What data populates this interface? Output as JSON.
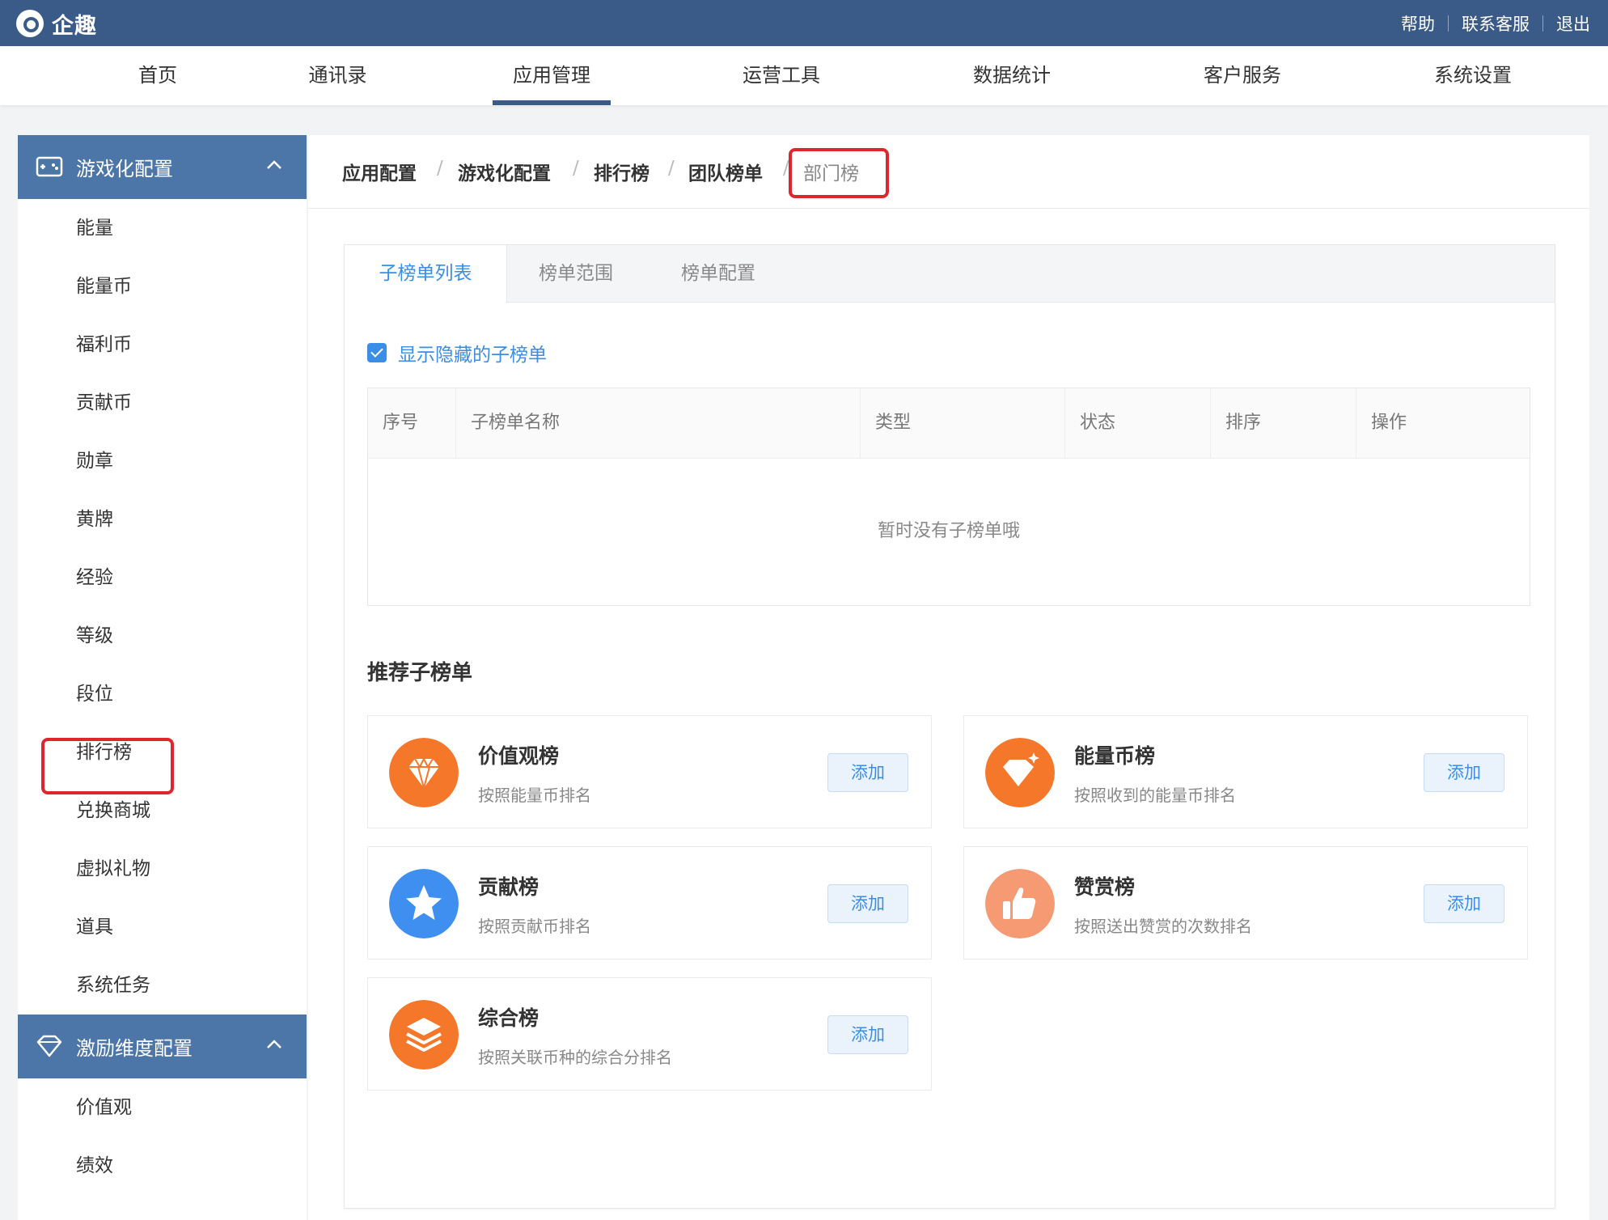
{
  "app": {
    "name": "企趣"
  },
  "toplinks": [
    "帮助",
    "联系客服",
    "退出"
  ],
  "nav": [
    "首页",
    "通讯录",
    "应用管理",
    "运营工具",
    "数据统计",
    "客户服务",
    "系统设置"
  ],
  "sidebar": {
    "group1": {
      "label": "游戏化配置",
      "items": [
        "能量",
        "能量币",
        "福利币",
        "贡献币",
        "勋章",
        "黄牌",
        "经验",
        "等级",
        "段位",
        "排行榜",
        "兑换商城",
        "虚拟礼物",
        "道具",
        "系统任务"
      ]
    },
    "group2": {
      "label": "激励维度配置",
      "items": [
        "价值观",
        "绩效"
      ]
    }
  },
  "breadcrumb": [
    "应用配置",
    "游戏化配置",
    "排行榜",
    "团队榜单",
    "部门榜"
  ],
  "tabs": [
    "子榜单列表",
    "榜单范围",
    "榜单配置"
  ],
  "show_hidden_label": "显示隐藏的子榜单",
  "table": {
    "headers": [
      "序号",
      "子榜单名称",
      "类型",
      "状态",
      "排序",
      "操作"
    ],
    "empty_text": "暂时没有子榜单哦"
  },
  "recommend": {
    "title": "推荐子榜单",
    "cards": [
      {
        "title": "价值观榜",
        "desc": "按照能量币排名",
        "button": "添加",
        "icon": "diamond-icon",
        "color": "#f5772a"
      },
      {
        "title": "能量币榜",
        "desc": "按照收到的能量币排名",
        "button": "添加",
        "icon": "sparkle-diamond-icon",
        "color": "#f5772a"
      },
      {
        "title": "贡献榜",
        "desc": "按照贡献币排名",
        "button": "添加",
        "icon": "star-icon",
        "color": "#3f8ff0"
      },
      {
        "title": "赞赏榜",
        "desc": "按照送出赞赏的次数排名",
        "button": "添加",
        "icon": "thumbs-up-icon",
        "color": "#f69a74"
      },
      {
        "title": "综合榜",
        "desc": "按照关联币种的综合分排名",
        "button": "添加",
        "icon": "layers-icon",
        "color": "#f5772a"
      }
    ]
  },
  "colors": {
    "topbar": "#3a5a87",
    "sidebar_group": "#4c75a8",
    "accent": "#3a8ee6",
    "highlight": "#e0262d"
  }
}
